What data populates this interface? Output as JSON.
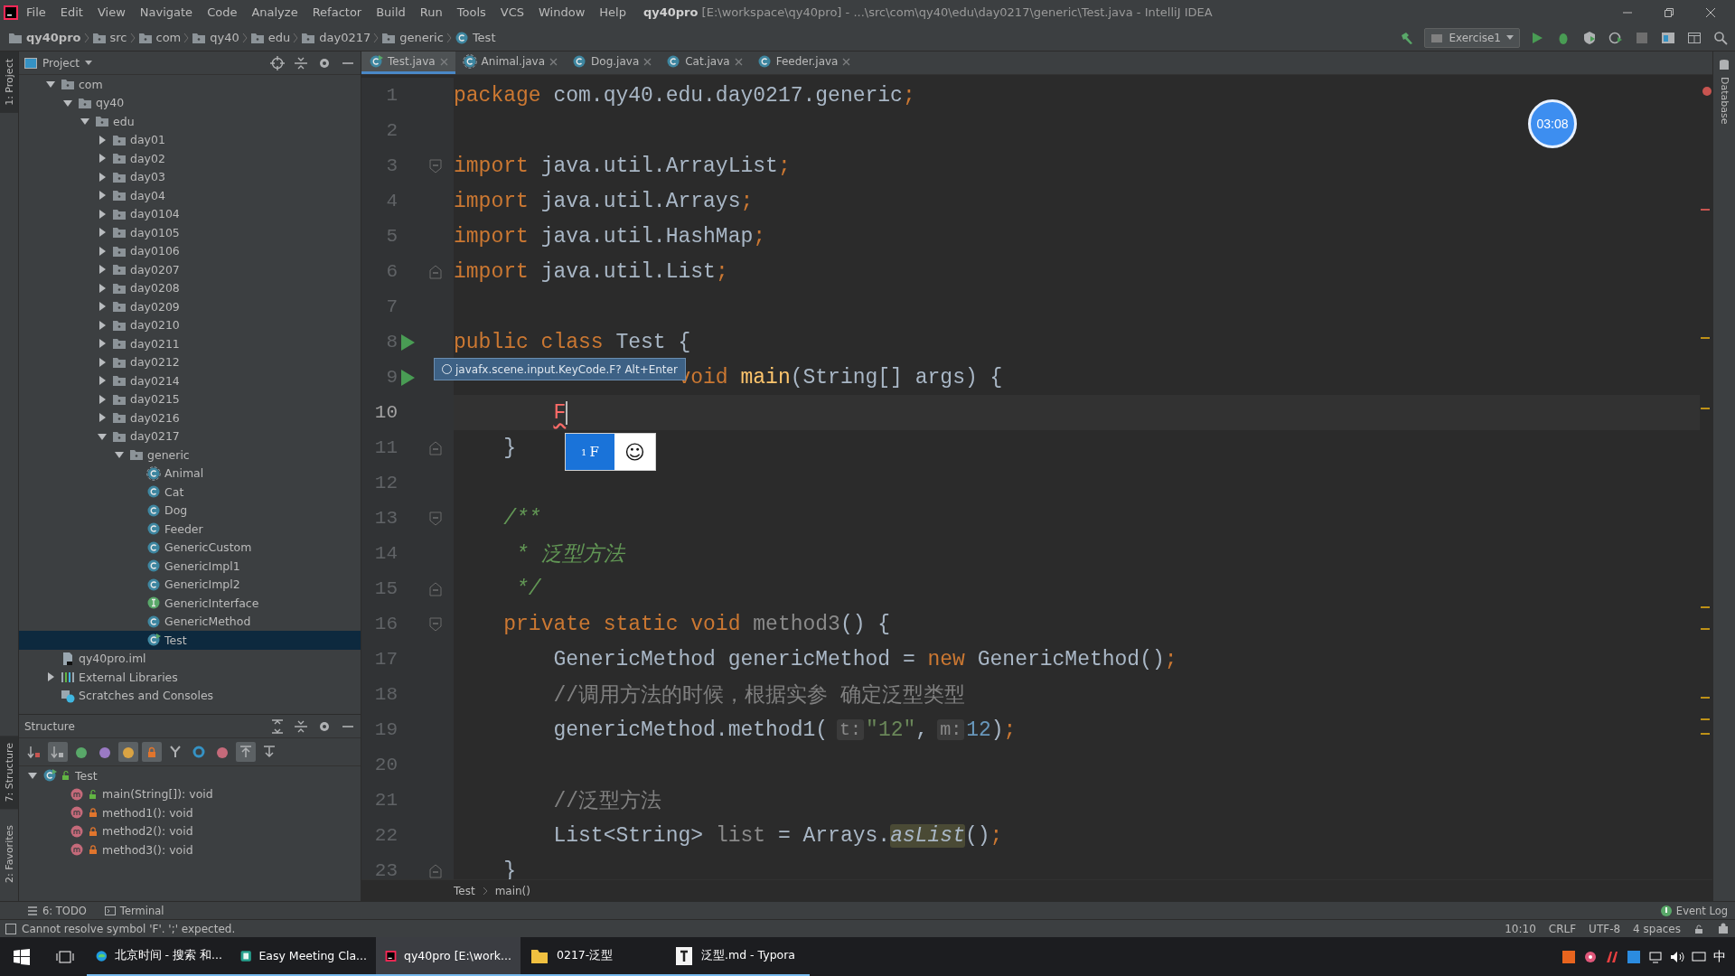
{
  "window": {
    "title": "**qy40pro** [E:\\workspace\\qy40pro] - ...\\src\\com\\qy40\\edu\\day0217\\generic\\Test.java - IntelliJ IDEA"
  },
  "menu": [
    "File",
    "Edit",
    "View",
    "Navigate",
    "Code",
    "Analyze",
    "Refactor",
    "Build",
    "Run",
    "Tools",
    "VCS",
    "Window",
    "Help"
  ],
  "breadcrumbs": [
    {
      "label": "qy40pro",
      "kind": "project"
    },
    {
      "label": "src",
      "kind": "folder"
    },
    {
      "label": "com",
      "kind": "folder"
    },
    {
      "label": "qy40",
      "kind": "folder"
    },
    {
      "label": "edu",
      "kind": "folder"
    },
    {
      "label": "day0217",
      "kind": "folder"
    },
    {
      "label": "generic",
      "kind": "folder"
    },
    {
      "label": "Test",
      "kind": "class"
    }
  ],
  "run_config": {
    "label": "Exercise1"
  },
  "left_strip": [
    {
      "label": "1: Project",
      "selected": true
    },
    {
      "label": "7: Structure",
      "selected": true
    },
    {
      "label": "2: Favorites",
      "selected": false
    }
  ],
  "project_panel": {
    "title": "Project",
    "tree": [
      {
        "label": "com",
        "kind": "package",
        "expanded": true,
        "selected": false,
        "children": [
          {
            "label": "qy40",
            "kind": "package",
            "expanded": true,
            "selected": false,
            "children": [
              {
                "label": "edu",
                "kind": "package",
                "expanded": true,
                "selected": false,
                "children": [
                  {
                    "label": "day01",
                    "kind": "package",
                    "expanded": false,
                    "selected": false
                  },
                  {
                    "label": "day02",
                    "kind": "package",
                    "expanded": false,
                    "selected": false
                  },
                  {
                    "label": "day03",
                    "kind": "package",
                    "expanded": false,
                    "selected": false
                  },
                  {
                    "label": "day04",
                    "kind": "package",
                    "expanded": false,
                    "selected": false
                  },
                  {
                    "label": "day0104",
                    "kind": "package",
                    "expanded": false,
                    "selected": false
                  },
                  {
                    "label": "day0105",
                    "kind": "package",
                    "expanded": false,
                    "selected": false
                  },
                  {
                    "label": "day0106",
                    "kind": "package",
                    "expanded": false,
                    "selected": false
                  },
                  {
                    "label": "day0207",
                    "kind": "package",
                    "expanded": false,
                    "selected": false
                  },
                  {
                    "label": "day0208",
                    "kind": "package",
                    "expanded": false,
                    "selected": false
                  },
                  {
                    "label": "day0209",
                    "kind": "package",
                    "expanded": false,
                    "selected": false
                  },
                  {
                    "label": "day0210",
                    "kind": "package",
                    "expanded": false,
                    "selected": false
                  },
                  {
                    "label": "day0211",
                    "kind": "package",
                    "expanded": false,
                    "selected": false
                  },
                  {
                    "label": "day0212",
                    "kind": "package",
                    "expanded": false,
                    "selected": false
                  },
                  {
                    "label": "day0214",
                    "kind": "package",
                    "expanded": false,
                    "selected": false
                  },
                  {
                    "label": "day0215",
                    "kind": "package",
                    "expanded": false,
                    "selected": false
                  },
                  {
                    "label": "day0216",
                    "kind": "package",
                    "expanded": false,
                    "selected": false
                  },
                  {
                    "label": "day0217",
                    "kind": "package",
                    "expanded": true,
                    "selected": false,
                    "children": [
                      {
                        "label": "generic",
                        "kind": "package",
                        "expanded": true,
                        "selected": false,
                        "children": [
                          {
                            "label": "Animal",
                            "kind": "abstract-class",
                            "selected": false
                          },
                          {
                            "label": "Cat",
                            "kind": "class",
                            "selected": false
                          },
                          {
                            "label": "Dog",
                            "kind": "class",
                            "selected": false
                          },
                          {
                            "label": "Feeder",
                            "kind": "class",
                            "selected": false
                          },
                          {
                            "label": "GenericCustom",
                            "kind": "class",
                            "selected": false
                          },
                          {
                            "label": "GenericImpl1",
                            "kind": "class",
                            "selected": false
                          },
                          {
                            "label": "GenericImpl2",
                            "kind": "class",
                            "selected": false
                          },
                          {
                            "label": "GenericInterface",
                            "kind": "interface",
                            "selected": false
                          },
                          {
                            "label": "GenericMethod",
                            "kind": "class",
                            "selected": false
                          },
                          {
                            "label": "Test",
                            "kind": "main-class",
                            "selected": true
                          }
                        ]
                      }
                    ]
                  }
                ]
              }
            ]
          }
        ]
      },
      {
        "label": "qy40pro.iml",
        "kind": "module-file",
        "selected": false
      },
      {
        "label": "External Libraries",
        "kind": "libraries",
        "expanded": false,
        "selected": false
      },
      {
        "label": "Scratches and Consoles",
        "kind": "scratches",
        "selected": false
      }
    ]
  },
  "structure_panel": {
    "title": "Structure",
    "toolbar": [
      {
        "kind": "sort-visibility",
        "on": false
      },
      {
        "kind": "sort-alpha",
        "on": true
      },
      {
        "kind": "inherited",
        "on": false
      },
      {
        "kind": "properties",
        "on": false
      },
      {
        "kind": "fields",
        "on": true
      },
      {
        "kind": "non-public",
        "on": true
      },
      {
        "kind": "merge",
        "on": false
      },
      {
        "kind": "anonymous",
        "on": false
      },
      {
        "kind": "lambdas",
        "on": false
      },
      {
        "kind": "scroll-to-source",
        "on": true
      },
      {
        "kind": "scroll-from-source",
        "on": false
      }
    ],
    "tree": [
      {
        "label": "Test",
        "kind": "main-class",
        "locked": false,
        "expanded": true,
        "children": [
          {
            "label": "main(String[]): void",
            "kind": "method",
            "locked": false
          },
          {
            "label": "method1(): void",
            "kind": "method",
            "locked": true
          },
          {
            "label": "method2(): void",
            "kind": "method",
            "locked": true
          },
          {
            "label": "method3(): void",
            "kind": "method",
            "locked": true
          }
        ]
      }
    ]
  },
  "editor": {
    "tabs": [
      {
        "label": "Test.java",
        "kind": "main-class",
        "selected": true
      },
      {
        "label": "Animal.java",
        "kind": "abstract-class",
        "selected": false
      },
      {
        "label": "Dog.java",
        "kind": "class",
        "selected": false
      },
      {
        "label": "Cat.java",
        "kind": "class",
        "selected": false
      },
      {
        "label": "Feeder.java",
        "kind": "class",
        "selected": false
      }
    ],
    "lines": [
      {
        "number": "1",
        "current": false,
        "kind": "plain",
        "tokens": [
          {
            "kind": "kw",
            "text": "package"
          },
          {
            "kind": "plain",
            "text": " com.qy40.edu.day0217.generic"
          },
          {
            "kind": "kw",
            "text": ";"
          }
        ]
      },
      {
        "number": "2",
        "current": false,
        "kind": "plain"
      },
      {
        "number": "3",
        "current": false,
        "kind": "fold",
        "tokens": [
          {
            "kind": "kw",
            "text": "import"
          },
          {
            "kind": "plain",
            "text": " java.util.ArrayList"
          },
          {
            "kind": "kw",
            "text": ";"
          }
        ]
      },
      {
        "number": "4",
        "current": false,
        "kind": "plain",
        "tokens": [
          {
            "kind": "kw",
            "text": "import"
          },
          {
            "kind": "plain",
            "text": " java.util.Arrays"
          },
          {
            "kind": "kw",
            "text": ";"
          }
        ]
      },
      {
        "number": "5",
        "current": false,
        "kind": "plain",
        "tokens": [
          {
            "kind": "kw",
            "text": "import"
          },
          {
            "kind": "plain",
            "text": " java.util.HashMap"
          },
          {
            "kind": "kw",
            "text": ";"
          }
        ]
      },
      {
        "number": "6",
        "current": false,
        "kind": "fold-end",
        "tokens": [
          {
            "kind": "kw",
            "text": "import"
          },
          {
            "kind": "plain",
            "text": " java.util.List"
          },
          {
            "kind": "kw",
            "text": ";"
          }
        ]
      },
      {
        "number": "7",
        "current": false,
        "kind": "plain"
      },
      {
        "number": "8",
        "current": false,
        "kind": "run",
        "tokens": [
          {
            "kind": "kw",
            "text": "public class"
          },
          {
            "kind": "plain",
            "text": " Test {"
          }
        ]
      },
      {
        "number": "9",
        "current": false,
        "kind": "run",
        "tokens": [
          {
            "kind": "kw",
            "text": "                  void"
          },
          {
            "kind": "fn",
            "text": " main"
          },
          {
            "kind": "plain",
            "text": "(String[] args) {"
          }
        ]
      },
      {
        "number": "10",
        "current": true,
        "kind": "plain",
        "tokens": [
          {
            "kind": "error",
            "text": "        F"
          }
        ]
      },
      {
        "number": "11",
        "current": false,
        "kind": "fold-end",
        "tokens": [
          {
            "kind": "plain",
            "text": "    }"
          }
        ]
      },
      {
        "number": "12",
        "current": false,
        "kind": "plain"
      },
      {
        "number": "13",
        "current": false,
        "kind": "fold",
        "tokens": [
          {
            "kind": "doc",
            "text": "    /**"
          }
        ]
      },
      {
        "number": "14",
        "current": false,
        "kind": "plain",
        "tokens": [
          {
            "kind": "doc",
            "text": "     * 泛型方法"
          }
        ]
      },
      {
        "number": "15",
        "current": false,
        "kind": "fold-end",
        "tokens": [
          {
            "kind": "doc",
            "text": "     */"
          }
        ]
      },
      {
        "number": "16",
        "current": false,
        "kind": "fold",
        "tokens": [
          {
            "kind": "kw",
            "text": "    private static void"
          },
          {
            "kind": "unused",
            "text": " method3"
          },
          {
            "kind": "plain",
            "text": "() {"
          }
        ]
      },
      {
        "number": "17",
        "current": false,
        "kind": "plain",
        "tokens": [
          {
            "kind": "plain",
            "text": "        GenericMethod genericMethod = "
          },
          {
            "kind": "kw",
            "text": "new"
          },
          {
            "kind": "plain",
            "text": " GenericMethod()"
          },
          {
            "kind": "kw",
            "text": ";"
          }
        ]
      },
      {
        "number": "18",
        "current": false,
        "kind": "plain",
        "tokens": [
          {
            "kind": "comment",
            "text": "        //调用方法的时候，根据实参 确定泛型类型"
          }
        ]
      },
      {
        "number": "19",
        "current": false,
        "kind": "plain",
        "tokens": [
          {
            "kind": "plain",
            "text": "        genericMethod.method1("
          },
          {
            "kind": "hint",
            "text": "t:"
          },
          {
            "kind": "str",
            "text": "\"12\""
          },
          {
            "kind": "plain",
            "text": ","
          },
          {
            "kind": "hint",
            "text": "m:"
          },
          {
            "kind": "num",
            "text": "12"
          },
          {
            "kind": "plain",
            "text": ")"
          },
          {
            "kind": "kw",
            "text": ";"
          }
        ]
      },
      {
        "number": "20",
        "current": false,
        "kind": "plain"
      },
      {
        "number": "21",
        "current": false,
        "kind": "plain",
        "tokens": [
          {
            "kind": "comment",
            "text": "        //泛型方法"
          }
        ]
      },
      {
        "number": "22",
        "current": false,
        "kind": "plain",
        "tokens": [
          {
            "kind": "plain",
            "text": "        List<String>"
          },
          {
            "kind": "unused",
            "text": " list"
          },
          {
            "kind": "plain",
            "text": " = Arrays."
          },
          {
            "kind": "static",
            "text": "asList"
          },
          {
            "kind": "plain",
            "text": "()"
          },
          {
            "kind": "kw",
            "text": ";"
          }
        ]
      },
      {
        "number": "23",
        "current": false,
        "kind": "fold-end",
        "tokens": [
          {
            "kind": "plain",
            "text": "    }"
          }
        ]
      }
    ],
    "tooltip": {
      "text": "javafx.scene.input.KeyCode.F? Alt+Enter"
    },
    "ime": {
      "index": "1",
      "candidate": "F",
      "emoji": "☺"
    },
    "timer": "03:08",
    "path": [
      "Test",
      "main()"
    ]
  },
  "right_strip": {
    "label": "Database"
  },
  "tool_buttons": [
    {
      "label": "6: TODO",
      "kind": "todo"
    },
    {
      "label": "Terminal",
      "kind": "terminal"
    }
  ],
  "event_log": "Event Log",
  "status_bar": {
    "message": "Cannot resolve symbol 'F'. ';' expected.",
    "items": [
      "10:10",
      "CRLF",
      "UTF-8",
      "4 spaces"
    ]
  },
  "taskbar": {
    "apps": [
      {
        "label": "北京时间 - 搜索 和...",
        "kind": "browser",
        "selected": false
      },
      {
        "label": "Easy Meeting Cla...",
        "kind": "meeting",
        "selected": false
      },
      {
        "label": "qy40pro [E:\\work...",
        "kind": "ide",
        "selected": true
      },
      {
        "label": "0217-泛型",
        "kind": "folder",
        "selected": false
      },
      {
        "label": "泛型.md - Typora",
        "kind": "typora",
        "selected": false
      }
    ],
    "language": "中"
  }
}
